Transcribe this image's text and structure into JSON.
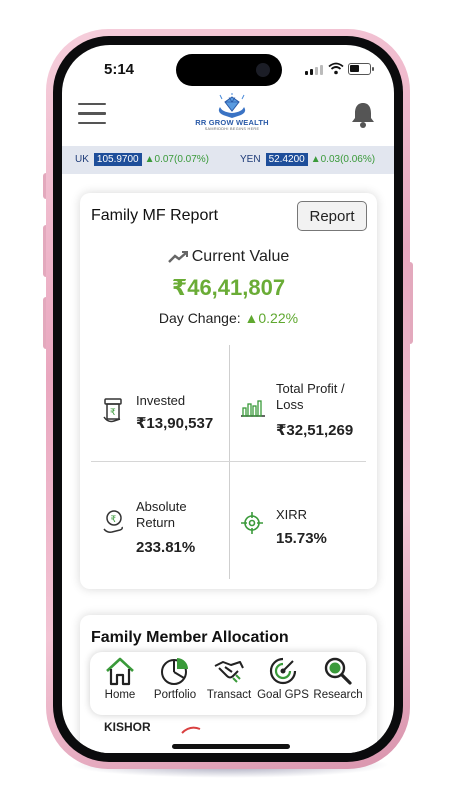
{
  "status_bar": {
    "time": "5:14"
  },
  "header": {
    "brand": "RR GROW WEALTH",
    "tagline": "SAMRIDDHI BEGINS HERE"
  },
  "ticker": [
    {
      "name": "UK",
      "value": "105.9700",
      "change": "▲0.07(0.07%)"
    },
    {
      "name": "YEN",
      "value": "52.4200",
      "change": "▲0.03(0.06%)"
    }
  ],
  "report": {
    "title": "Family MF Report",
    "report_button": "Report",
    "current_value_label": "Current Value",
    "current_value": "₹46,41,807",
    "day_change_label": "Day Change:",
    "day_change_value": "▲0.22%",
    "invested_label": "Invested",
    "invested_value": "₹13,90,537",
    "profit_label_1": "Total Profit /",
    "profit_label_2": "Loss",
    "profit_value": "₹32,51,269",
    "abs_label_1": "Absolute",
    "abs_label_2": "Return",
    "abs_value": "233.81%",
    "xirr_label": "XIRR",
    "xirr_value": "15.73%"
  },
  "allocation": {
    "title": "Family Member Allocation",
    "member_partial": "KISHOR"
  },
  "bottom_nav": {
    "home": "Home",
    "portfolio": "Portfolio",
    "transact": "Transact",
    "goal_gps": "Goal GPS",
    "research": "Research"
  },
  "colors": {
    "accent_green": "#6aac36",
    "ticker_bg": "#e2e6ef",
    "ticker_value_bg": "#1e4e9a",
    "frame_pink": "#e9a7bf"
  }
}
